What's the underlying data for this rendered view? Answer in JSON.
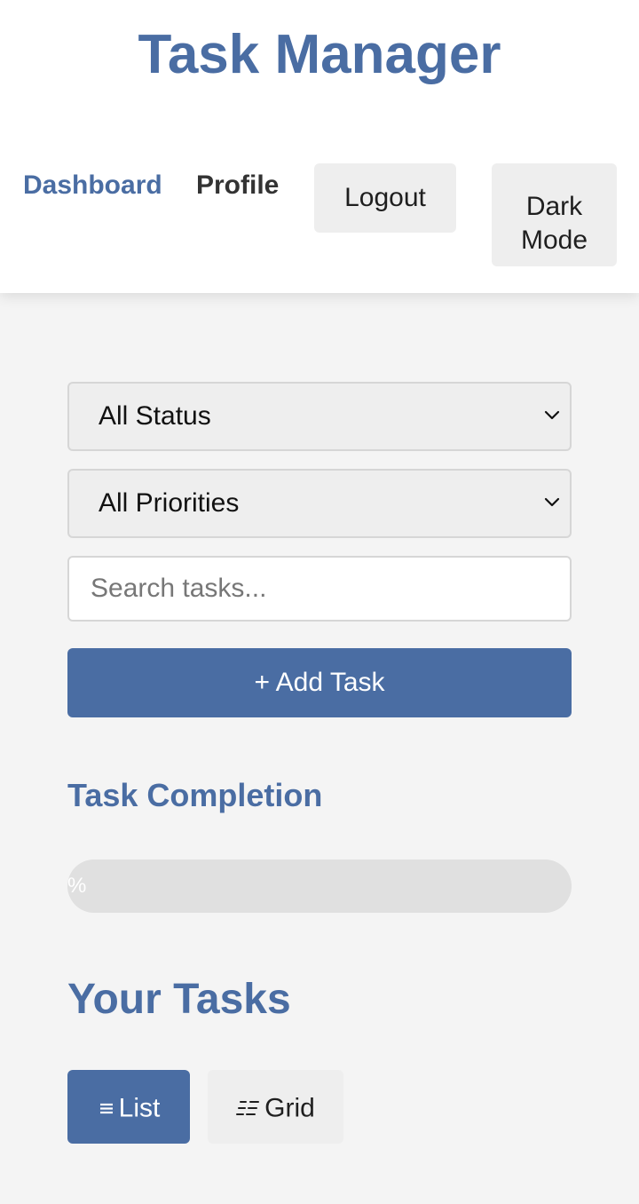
{
  "app": {
    "title": "Task Manager"
  },
  "nav": {
    "dashboard_label": "Dashboard",
    "profile_label": "Profile",
    "logout_label": "Logout",
    "dark_mode_line1": "Dark",
    "dark_mode_line2": "Mode"
  },
  "filters": {
    "status_selected": "All Status",
    "priority_selected": "All Priorities"
  },
  "search": {
    "placeholder": "Search tasks...",
    "value": ""
  },
  "actions": {
    "add_task_label": "+ Add Task"
  },
  "completion": {
    "title": "Task Completion",
    "percent_fraction": 0,
    "label": "%"
  },
  "tasks": {
    "title": "Your Tasks",
    "view_list_label": "List",
    "view_grid_label": "Grid",
    "active_view": "list"
  },
  "icons": {
    "chevron": "chevron-down-icon",
    "list": "list-icon",
    "grid": "grid-icon"
  },
  "colors": {
    "accent": "#4a6da3",
    "background": "#f4f4f4",
    "header_background": "#ffffff",
    "button_gray": "#eeeeee",
    "progress_track": "#e0e0e0"
  }
}
